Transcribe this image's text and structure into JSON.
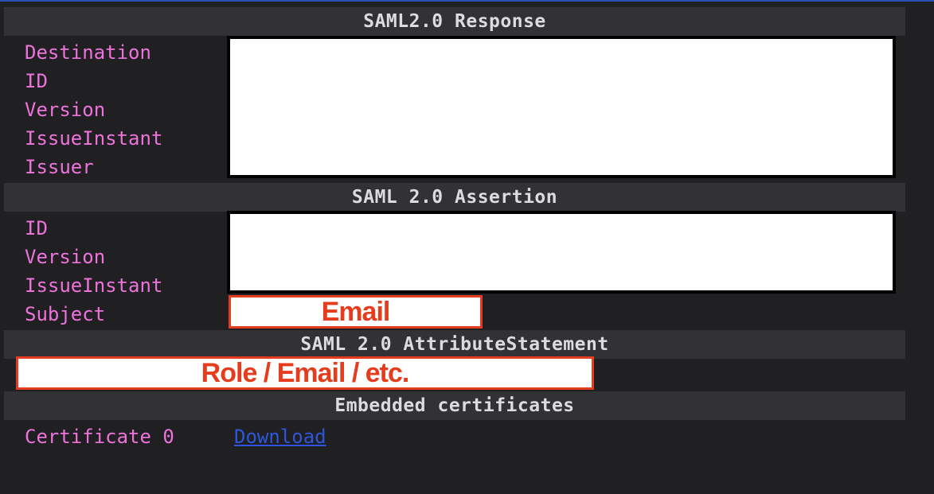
{
  "sections": {
    "response": {
      "title": "SAML2.0 Response",
      "fields": [
        "Destination",
        "ID",
        "Version",
        "IssueInstant",
        "Issuer"
      ]
    },
    "assertion": {
      "title": "SAML 2.0 Assertion",
      "fields": [
        "ID",
        "Version",
        "IssueInstant",
        "Subject"
      ],
      "subject_annotation": "Email"
    },
    "attribute_statement": {
      "title": "SAML 2.0 AttributeStatement",
      "annotation": "Role / Email / etc."
    },
    "certificates": {
      "title": "Embedded certificates",
      "items": [
        {
          "label": "Certificate 0",
          "link": "Download"
        }
      ]
    }
  },
  "colors": {
    "label": "#ee72dc",
    "link": "#2e55dd",
    "annotation": "#e43c1c",
    "header_bg": "#313136",
    "background": "#202023"
  }
}
